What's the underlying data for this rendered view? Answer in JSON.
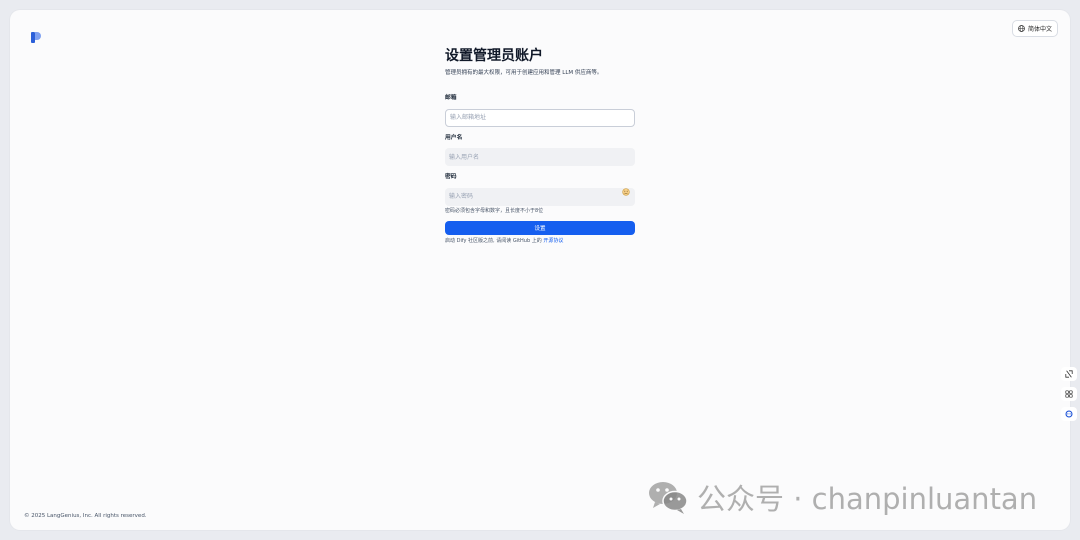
{
  "header": {
    "logo_icon": "dify-logo-icon",
    "language_label": "简体中文",
    "language_icon": "globe-icon"
  },
  "form": {
    "title": "设置管理员账户",
    "subtitle": "管理员拥有的最大权限，可用于创建应用和管理 LLM 供应商等。",
    "email": {
      "label": "邮箱",
      "placeholder": "输入邮箱地址",
      "value": ""
    },
    "username": {
      "label": "用户名",
      "placeholder": "输入用户名",
      "value": ""
    },
    "password": {
      "label": "密码",
      "placeholder": "输入密码",
      "value": "",
      "hint": "密码必须包含字母和数字，且长度不小于8位"
    },
    "submit_label": "设置",
    "notice_prefix": "启动 Dify 社区版之前, 请阅读 GitHub 上的",
    "notice_link": "开源协议"
  },
  "footer": {
    "copyright": "© 2025 LangGenius, Inc. All rights reserved."
  },
  "side_tools": [
    "collapse-icon",
    "grid-icon",
    "assistant-icon"
  ],
  "watermark": {
    "text": "公众号 · chanpinluantan",
    "icon": "wechat-icon"
  },
  "colors": {
    "primary": "#155eef",
    "background": "#e9ebf0",
    "card": "#fbfbfc"
  }
}
